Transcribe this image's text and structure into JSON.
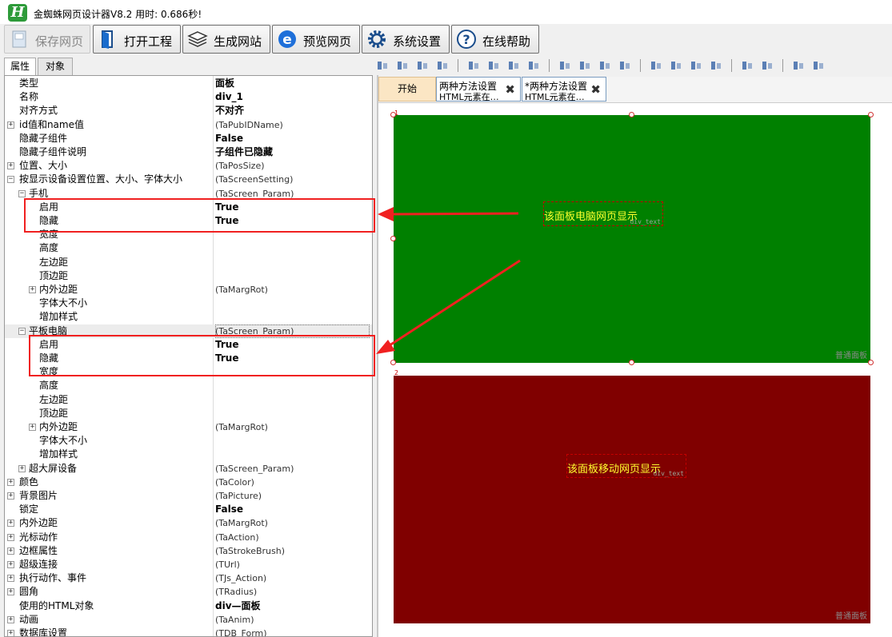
{
  "window": {
    "title": "金蜘蛛网页设计器V8.2 用时: 0.686秒!",
    "logo_letter": "H"
  },
  "toolbar": {
    "buttons": [
      {
        "label": "保存网页",
        "icon": "save-icon",
        "enabled": false
      },
      {
        "label": "打开工程",
        "icon": "open-project-icon",
        "enabled": true
      },
      {
        "label": "生成网站",
        "icon": "layers-icon",
        "enabled": true
      },
      {
        "label": "预览网页",
        "icon": "browser-icon",
        "enabled": true
      },
      {
        "label": "系统设置",
        "icon": "gear-icon",
        "enabled": true
      },
      {
        "label": "在线帮助",
        "icon": "help-icon",
        "enabled": true
      }
    ]
  },
  "left_tabs": [
    {
      "label": "属性",
      "active": true
    },
    {
      "label": "对象",
      "active": false
    }
  ],
  "properties": [
    {
      "name": "类型",
      "value": "面板",
      "bold": true,
      "level": 0,
      "expandable": false
    },
    {
      "name": "名称",
      "value": "div_1",
      "bold": true,
      "level": 0,
      "expandable": false
    },
    {
      "name": "对齐方式",
      "value": "不对齐",
      "bold": true,
      "level": 0,
      "expandable": false
    },
    {
      "name": "id值和name值",
      "value": "(TaPubIDName)",
      "bold": false,
      "level": 0,
      "expandable": true
    },
    {
      "name": "隐藏子组件",
      "value": "False",
      "bold": true,
      "level": 0,
      "expandable": false
    },
    {
      "name": "隐藏子组件说明",
      "value": "子组件已隐藏",
      "bold": true,
      "level": 0,
      "expandable": false
    },
    {
      "name": "位置、大小",
      "value": "(TaPosSize)",
      "bold": false,
      "level": 0,
      "expandable": true
    },
    {
      "name": "按显示设备设置位置、大小、字体大小",
      "value": "(TaScreenSetting)",
      "bold": false,
      "level": 0,
      "expandable": true,
      "expanded": true
    },
    {
      "name": "手机",
      "value": "(TaScreen_Param)",
      "bold": false,
      "level": 1,
      "expandable": true,
      "expanded": true
    },
    {
      "name": "启用",
      "value": "True",
      "bold": true,
      "level": 2,
      "expandable": false
    },
    {
      "name": "隐藏",
      "value": "True",
      "bold": true,
      "level": 2,
      "expandable": false
    },
    {
      "name": "宽度",
      "value": "",
      "bold": false,
      "level": 2,
      "expandable": false
    },
    {
      "name": "高度",
      "value": "",
      "bold": false,
      "level": 2,
      "expandable": false
    },
    {
      "name": "左边距",
      "value": "",
      "bold": false,
      "level": 2,
      "expandable": false
    },
    {
      "name": "顶边距",
      "value": "",
      "bold": false,
      "level": 2,
      "expandable": false
    },
    {
      "name": "内外边距",
      "value": "(TaMargRot)",
      "bold": false,
      "level": 2,
      "expandable": true
    },
    {
      "name": "字体大不小",
      "value": "",
      "bold": false,
      "level": 2,
      "expandable": false
    },
    {
      "name": "增加样式",
      "value": "",
      "bold": false,
      "level": 2,
      "expandable": false
    },
    {
      "name": "平板电脑",
      "value": "(TaScreen_Param)",
      "bold": false,
      "level": 1,
      "expandable": true,
      "expanded": true,
      "selected": true
    },
    {
      "name": "启用",
      "value": "True",
      "bold": true,
      "level": 2,
      "expandable": false
    },
    {
      "name": "隐藏",
      "value": "True",
      "bold": true,
      "level": 2,
      "expandable": false
    },
    {
      "name": "宽度",
      "value": "",
      "bold": false,
      "level": 2,
      "expandable": false
    },
    {
      "name": "高度",
      "value": "",
      "bold": false,
      "level": 2,
      "expandable": false
    },
    {
      "name": "左边距",
      "value": "",
      "bold": false,
      "level": 2,
      "expandable": false
    },
    {
      "name": "顶边距",
      "value": "",
      "bold": false,
      "level": 2,
      "expandable": false
    },
    {
      "name": "内外边距",
      "value": "(TaMargRot)",
      "bold": false,
      "level": 2,
      "expandable": true
    },
    {
      "name": "字体大不小",
      "value": "",
      "bold": false,
      "level": 2,
      "expandable": false
    },
    {
      "name": "增加样式",
      "value": "",
      "bold": false,
      "level": 2,
      "expandable": false
    },
    {
      "name": "超大屏设备",
      "value": "(TaScreen_Param)",
      "bold": false,
      "level": 1,
      "expandable": true
    },
    {
      "name": "颜色",
      "value": "(TaColor)",
      "bold": false,
      "level": 0,
      "expandable": true
    },
    {
      "name": "背景图片",
      "value": "(TaPicture)",
      "bold": false,
      "level": 0,
      "expandable": true
    },
    {
      "name": "锁定",
      "value": "False",
      "bold": true,
      "level": 0,
      "expandable": false
    },
    {
      "name": "内外边距",
      "value": "(TaMargRot)",
      "bold": false,
      "level": 0,
      "expandable": true
    },
    {
      "name": "光标动作",
      "value": "(TaAction)",
      "bold": false,
      "level": 0,
      "expandable": true
    },
    {
      "name": "边框属性",
      "value": "(TaStrokeBrush)",
      "bold": false,
      "level": 0,
      "expandable": true
    },
    {
      "name": "超级连接",
      "value": "(TUrl)",
      "bold": false,
      "level": 0,
      "expandable": true
    },
    {
      "name": "执行动作、事件",
      "value": "(TJs_Action)",
      "bold": false,
      "level": 0,
      "expandable": true
    },
    {
      "name": "圆角",
      "value": "(TRadius)",
      "bold": false,
      "level": 0,
      "expandable": true
    },
    {
      "name": "使用的HTML对象",
      "value": "div—面板",
      "bold": true,
      "level": 0,
      "expandable": false
    },
    {
      "name": "动画",
      "value": "(TaAnim)",
      "bold": false,
      "level": 0,
      "expandable": true
    },
    {
      "name": "数据库设置",
      "value": "(TDB_Form)",
      "bold": false,
      "level": 0,
      "expandable": true
    }
  ],
  "doc_tabs": {
    "start_label": "开始",
    "tabs": [
      {
        "line1": "两种方法设置",
        "line2": "HTML元素在…",
        "close": "✖"
      },
      {
        "line1": "*两种方法设置",
        "line2": "HTML元素在…",
        "close": "✖"
      }
    ]
  },
  "canvas": {
    "panel1": {
      "number": "1",
      "color": "#008000",
      "text": "该面板电脑网页显示",
      "text_sub": "div_text",
      "caption": "普通面板"
    },
    "panel2": {
      "number": "2",
      "color": "#800000",
      "text": "该面板移动网页显示",
      "text_sub": "div_text",
      "caption": "普通面板"
    }
  },
  "colors": {
    "highlight": "#f02020",
    "text_yellow": "#ffff2e"
  }
}
